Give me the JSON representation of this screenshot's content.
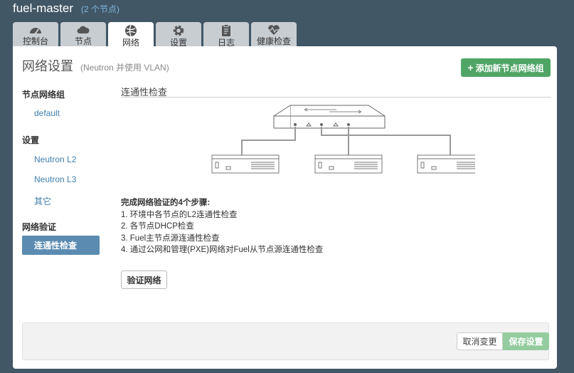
{
  "header": {
    "env_name": "fuel-master",
    "node_count": "(2 个节点)"
  },
  "tabs": [
    {
      "label": "控制台",
      "icon": "dashboard-icon"
    },
    {
      "label": "节点",
      "icon": "cloud-icon"
    },
    {
      "label": "网络",
      "icon": "network-icon",
      "active": true
    },
    {
      "label": "设置",
      "icon": "gear-icon"
    },
    {
      "label": "日志",
      "icon": "clipboard-icon"
    },
    {
      "label": "健康检查",
      "icon": "heartbeat-icon"
    }
  ],
  "panel": {
    "title": "网络设置",
    "subtitle": "(Neutron 并使用 VLAN)",
    "add_button": "添加新节点网络组",
    "add_button_icon": "+"
  },
  "sidebar": {
    "node_groups_heading": "节点网络组",
    "node_groups": [
      "default"
    ],
    "settings_heading": "设置",
    "settings_items": [
      "Neutron L2",
      "Neutron L3",
      "其它"
    ],
    "verification_heading": "网络验证",
    "verification_active": "连通性检查"
  },
  "content": {
    "section_title": "连通性检查",
    "steps_title": "完成网络验证的4个步骤:",
    "steps": [
      "1. 环境中各节点的L2连通性检查",
      "2. 各节点DHCP检查",
      "3. Fuel主节点源连通性检查",
      "4. 通过公网和管理(PXE)网络对Fuel从节点源连通性检查"
    ],
    "verify_button": "验证网络"
  },
  "footer": {
    "cancel_label": "取消变更",
    "save_label": "保存设置"
  },
  "colors": {
    "background": "#415766",
    "link": "#3f7fae",
    "success": "#4fa566",
    "active_sidebar": "#5b8bb0",
    "save_disabled": "#94cc9f"
  }
}
